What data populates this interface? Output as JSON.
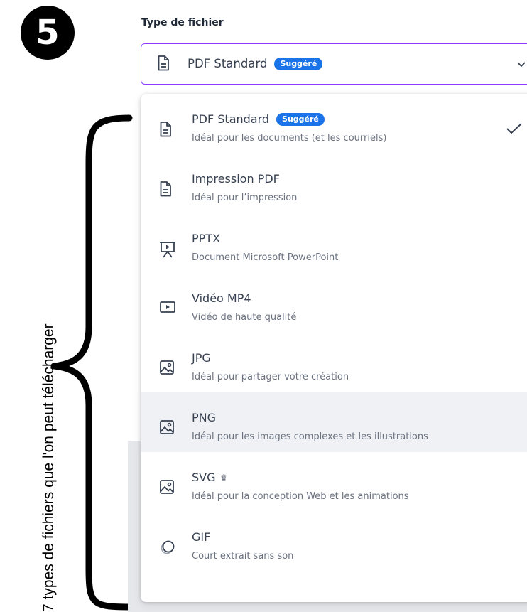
{
  "step_number": "5",
  "side_caption": "7 types de fichiers que l'on peut télécharger",
  "file_type": {
    "label": "Type de fichier",
    "selected": "PDF Standard",
    "selected_badge": "Suggéré",
    "selected_icon": "document-icon"
  },
  "options": [
    {
      "title": "PDF Standard",
      "badge": "Suggéré",
      "desc": "Idéal pour les documents (et les courriels)",
      "icon": "document-icon",
      "checked": true
    },
    {
      "title": "Impression PDF",
      "desc": "Idéal pour l’impression",
      "icon": "document-icon"
    },
    {
      "title": "PPTX",
      "desc": "Document Microsoft PowerPoint",
      "icon": "presentation-icon"
    },
    {
      "title": "Vidéo MP4",
      "desc": "Vidéo de haute qualité",
      "icon": "video-icon"
    },
    {
      "title": "JPG",
      "desc": "Idéal pour partager votre création",
      "icon": "image-icon"
    },
    {
      "title": "PNG",
      "desc": "Idéal pour les images complexes et les illustrations",
      "icon": "image-icon",
      "highlighted": true
    },
    {
      "title": "SVG",
      "crown": "♛",
      "desc": "Idéal pour la conception Web et les animations",
      "icon": "image-icon"
    },
    {
      "title": "GIF",
      "desc": "Court extrait sans son",
      "icon": "gif-icon"
    }
  ],
  "colors": {
    "accent_border": "#8b3dff",
    "badge_blue": "#1a73e8",
    "highlight_row": "#eff1f4"
  }
}
